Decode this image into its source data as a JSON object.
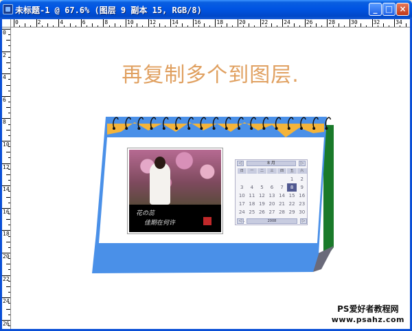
{
  "window": {
    "title": "未标题-1 @ 67.6% (图层 9 副本 15, RGB/8)",
    "minimize_glyph": "_",
    "maximize_glyph": "□",
    "close_glyph": "×"
  },
  "ruler": {
    "horizontal_labels": [
      "0",
      "2",
      "4",
      "6",
      "8",
      "10",
      "12",
      "14",
      "16",
      "18",
      "20",
      "22",
      "24",
      "26",
      "28",
      "30",
      "32",
      "34"
    ],
    "vertical_labels": [
      "0",
      "2",
      "4",
      "6",
      "8",
      "10",
      "12",
      "14",
      "16",
      "18",
      "20",
      "22",
      "24",
      "26"
    ]
  },
  "canvas": {
    "heading": "再复制多个到图层."
  },
  "calendar": {
    "colors": {
      "body": "#4a90e8",
      "side": "#1a7a2a",
      "zigzag": "#f4b43a",
      "page": "#ffffff"
    },
    "photo_caption_line1": "花の蕊",
    "photo_caption_line2": "佳期在何许",
    "widget": {
      "prev_glyph": "◁",
      "next_glyph": "▷",
      "month_label": "8 月",
      "year_label": "2008",
      "weekdays": [
        "日",
        "一",
        "二",
        "三",
        "四",
        "五",
        "六"
      ],
      "days": [
        "",
        "",
        "",
        "",
        "",
        "1",
        "2",
        "3",
        "4",
        "5",
        "6",
        "7",
        "8",
        "9",
        "10",
        "11",
        "12",
        "13",
        "14",
        "15",
        "16",
        "17",
        "18",
        "19",
        "20",
        "21",
        "22",
        "23",
        "24",
        "25",
        "26",
        "27",
        "28",
        "29",
        "30",
        "31",
        "",
        "",
        "",
        "",
        "",
        ""
      ],
      "selected_day": "8"
    }
  },
  "watermark": {
    "line1": "PS爱好者教程网",
    "line2": "www.psahz.com"
  }
}
